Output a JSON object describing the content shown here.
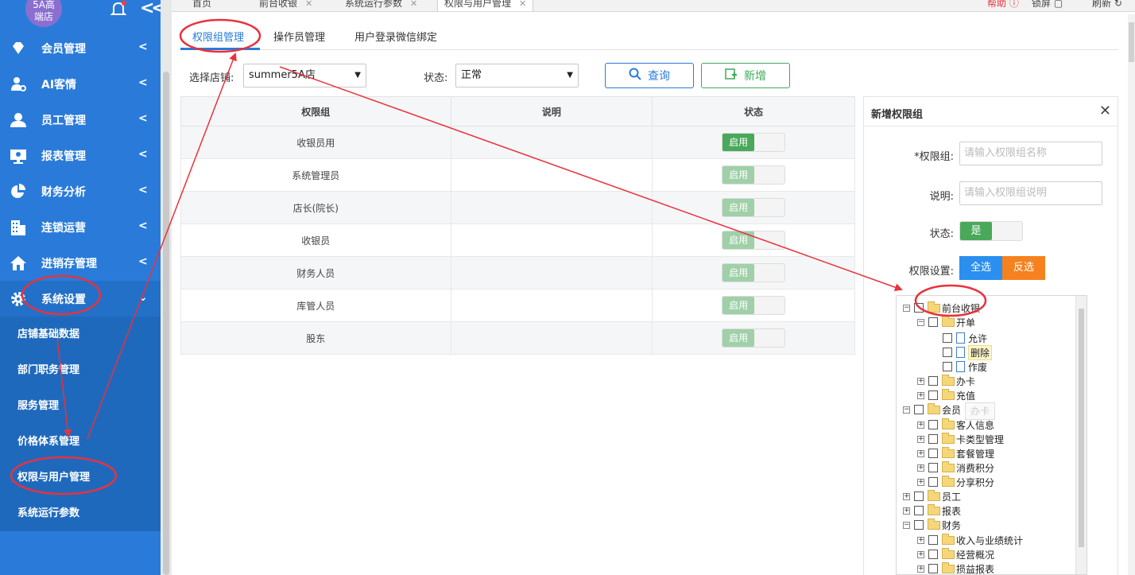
{
  "sidebar": {
    "logo": {
      "line1": "5A高",
      "line2": "端店"
    },
    "menu": [
      {
        "label": "会员管理",
        "icon": "diamond-icon"
      },
      {
        "label": "AI客情",
        "icon": "user-gear-icon"
      },
      {
        "label": "员工管理",
        "icon": "user-icon"
      },
      {
        "label": "报表管理",
        "icon": "monitor-chart-icon"
      },
      {
        "label": "财务分析",
        "icon": "pie-chart-icon"
      },
      {
        "label": "连锁运营",
        "icon": "building-icon"
      },
      {
        "label": "进销存管理",
        "icon": "house-icon"
      },
      {
        "label": "系统设置",
        "icon": "gear-icon"
      }
    ],
    "submenu": [
      "店铺基础数据",
      "部门职务管理",
      "服务管理",
      "价格体系管理",
      "权限与用户管理",
      "系统运行参数"
    ]
  },
  "topbar": {
    "tabs": [
      "首页",
      "前台收银",
      "系统运行参数",
      "权限与用户管理"
    ],
    "right": [
      "帮助",
      "锁屏",
      "刷新"
    ]
  },
  "page_tabs": [
    "权限组管理",
    "操作员管理",
    "用户登录微信绑定"
  ],
  "filters": {
    "store_label": "选择店铺:",
    "store_value": "summer5A店",
    "status_label": "状态:",
    "status_value": "正常",
    "query_label": "查询",
    "add_label": "新增"
  },
  "table": {
    "headers": [
      "权限组",
      "说明",
      "状态"
    ],
    "rows": [
      {
        "name": "收银员用",
        "desc": "",
        "status": "启用"
      },
      {
        "name": "系统管理员",
        "desc": "",
        "status": "启用"
      },
      {
        "name": "店长(院长)",
        "desc": "",
        "status": "启用"
      },
      {
        "name": "收银员",
        "desc": "",
        "status": "启用"
      },
      {
        "name": "财务人员",
        "desc": "",
        "status": "启用"
      },
      {
        "name": "库管人员",
        "desc": "",
        "status": "启用"
      },
      {
        "name": "股东",
        "desc": "",
        "status": "启用"
      }
    ]
  },
  "panel": {
    "title": "新增权限组",
    "group_label": "*权限组:",
    "group_placeholder": "请输入权限组名称",
    "desc_label": "说明:",
    "desc_placeholder": "请输入权限组说明",
    "status_label": "状态:",
    "status_on": "是",
    "perm_label": "权限设置:",
    "select_all": "全选",
    "invert": "反选"
  },
  "tree": [
    {
      "label": "前台收银",
      "switch": "⊟",
      "type": "folder"
    },
    {
      "label": "开单",
      "switch": "⊟",
      "type": "folder"
    },
    {
      "label": "允许",
      "type": "doc"
    },
    {
      "label": "删除",
      "type": "doc"
    },
    {
      "label": "作废",
      "type": "doc"
    },
    {
      "label": "办卡",
      "switch": "⊞",
      "type": "folder"
    },
    {
      "label": "充值",
      "switch": "⊞",
      "type": "folder"
    },
    {
      "label": "会员",
      "switch": "⊟",
      "type": "folder"
    },
    {
      "label": "客人信息",
      "switch": "⊞",
      "type": "folder"
    },
    {
      "label": "卡类型管理",
      "switch": "⊞",
      "type": "folder"
    },
    {
      "label": "套餐管理",
      "switch": "⊞",
      "type": "folder"
    },
    {
      "label": "消费积分",
      "switch": "⊞",
      "type": "folder"
    },
    {
      "label": "分享积分",
      "switch": "⊞",
      "type": "folder"
    },
    {
      "label": "员工",
      "switch": "⊞",
      "type": "folder"
    },
    {
      "label": "报表",
      "switch": "⊞",
      "type": "folder"
    },
    {
      "label": "财务",
      "switch": "⊟",
      "type": "folder"
    },
    {
      "label": "收入与业绩统计",
      "switch": "⊞",
      "type": "folder"
    },
    {
      "label": "经营概况",
      "switch": "⊞",
      "type": "folder"
    },
    {
      "label": "损益报表",
      "switch": "⊞",
      "type": "folder"
    }
  ],
  "tooltip": "办卡",
  "colors": {
    "sidebar": "#2a7bd9",
    "accent": "#2a7bd9",
    "success": "#4aa85a",
    "warning": "#f5821f",
    "annotation": "#e8323c"
  }
}
